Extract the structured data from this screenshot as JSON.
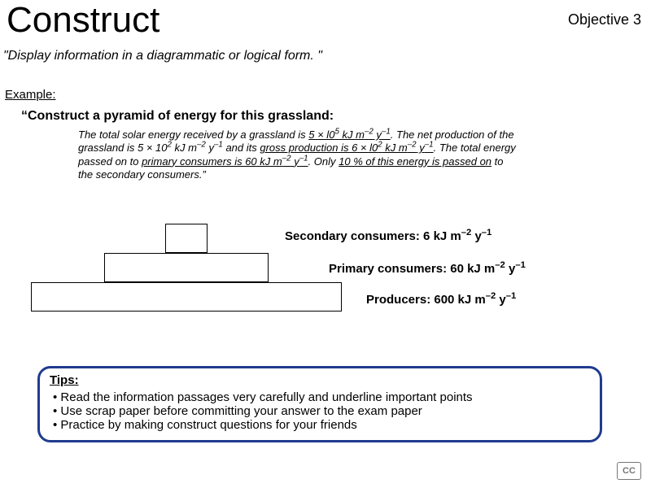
{
  "header": {
    "title": "Construct",
    "objective": "Objective 3",
    "definition": "\"Display information in a diagrammatic or logical form. \""
  },
  "example": {
    "label": "Example:",
    "prompt_prefix": "“Construct",
    "prompt_rest": " a pyramid of energy for this grassland:",
    "passage_html": "The total solar energy received by a grassland is <span class='u'>5 × l0<sup>5</sup> kJ m<sup>–2</sup> y<sup>–1</sup></span>. The net production of the grassland is 5 × 10<sup>2</sup> kJ m<sup>–2</sup> y<sup>–1</sup> and its <span class='u'>gross production is 6 × l0<sup>2</sup> kJ m<sup>–2</sup> y<sup>–1</sup></span>. The total energy passed on to <span class='u'>primary consumers is 60 kJ m<sup>–2</sup> y<sup>–1</sup></span>. Only <span class='u'>10 % of this energy is passed on</span> to the secondary consumers.”"
  },
  "pyramid": {
    "levels": [
      {
        "name": "Secondary consumers",
        "value_html": "6 kJ m<sup>–2</sup> y<sup>–1</sup>"
      },
      {
        "name": "Primary consumers",
        "value_html": "60 kJ m<sup>–2</sup> y<sup>–1</sup>"
      },
      {
        "name": "Producers",
        "value_html": "600 kJ m<sup>–2</sup> y<sup>–1</sup>"
      }
    ]
  },
  "tips": {
    "title": "Tips:",
    "items": [
      "Read the information passages very carefully and underline important points",
      "Use scrap paper before committing your answer to the exam paper",
      "Practice by making construct questions for your friends"
    ]
  },
  "footer": {
    "cc": "CC"
  }
}
